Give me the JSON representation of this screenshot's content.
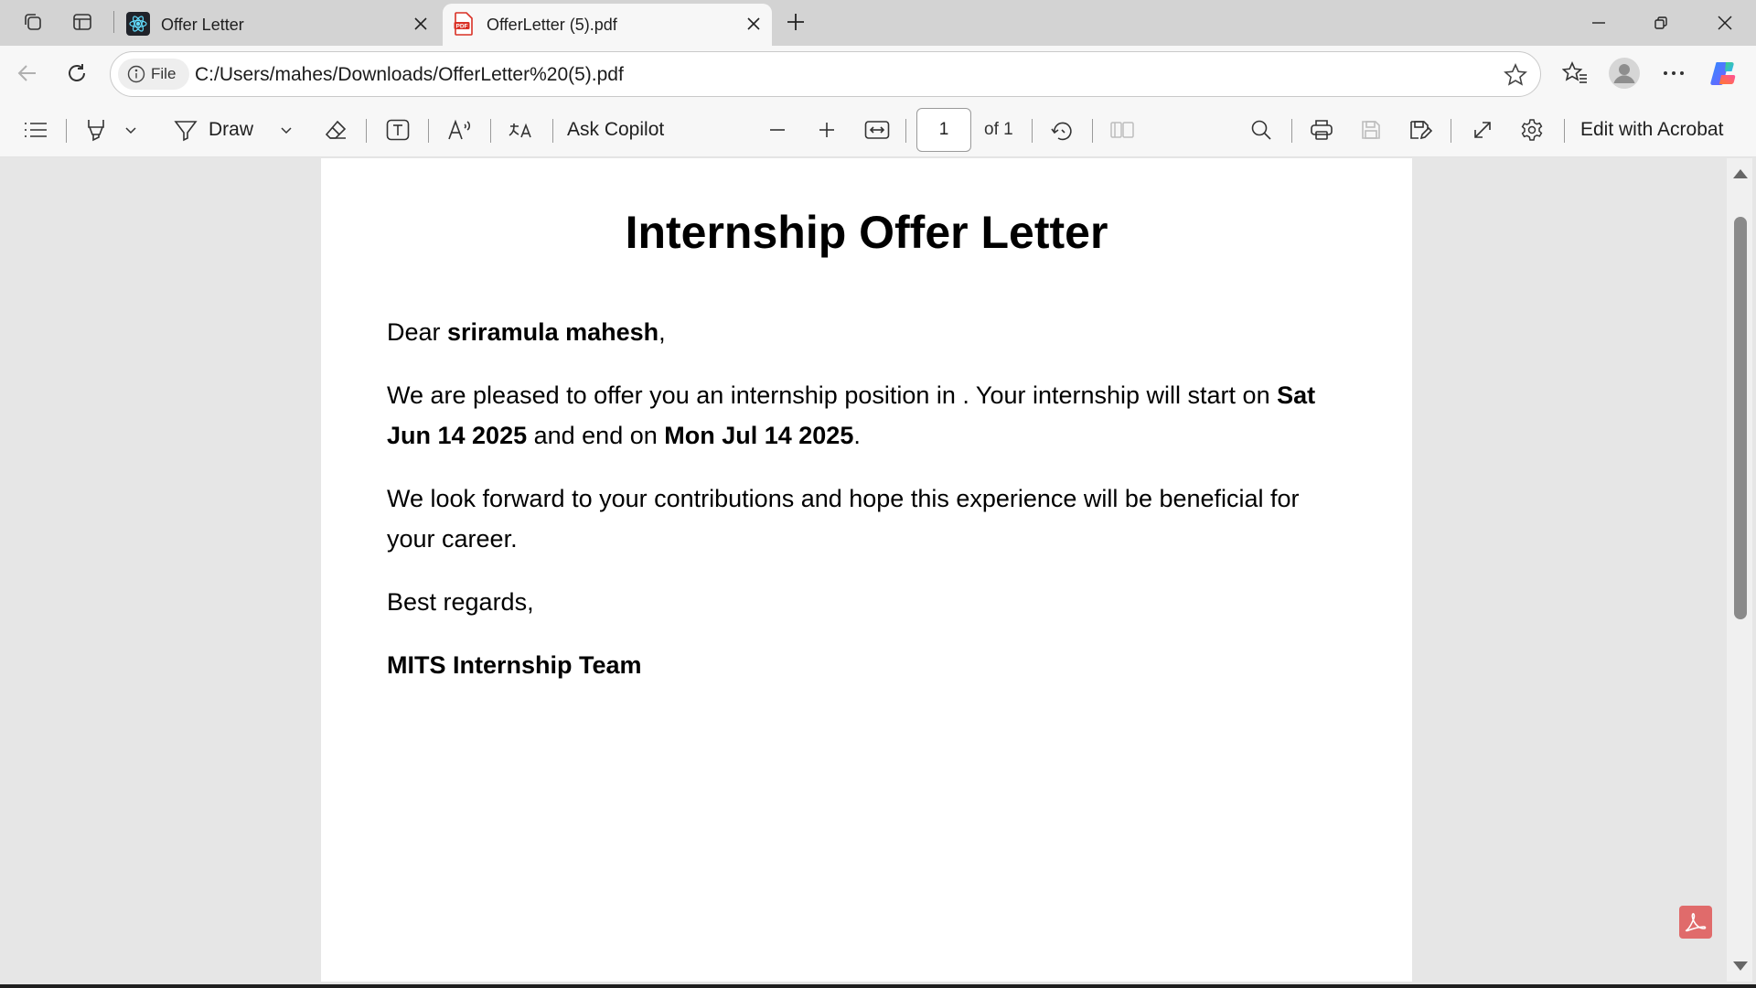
{
  "browser": {
    "tabs": [
      {
        "title": "Offer Letter",
        "icon": "react-icon",
        "active": false
      },
      {
        "title": "OfferLetter (5).pdf",
        "icon": "pdf-icon",
        "active": true
      }
    ],
    "new_tab_icon": "plus-icon",
    "window_controls": [
      "minimize-icon",
      "restore-icon",
      "close-icon"
    ]
  },
  "address_bar": {
    "scheme_label": "File",
    "url": "C:/Users/mahes/Downloads/OfferLetter%20(5).pdf"
  },
  "pdf_toolbar": {
    "draw_label": "Draw",
    "ask_copilot_label": "Ask Copilot",
    "page_current": "1",
    "page_total_label": "of 1",
    "edit_acrobat_label": "Edit with Acrobat"
  },
  "document": {
    "title": "Internship Offer Letter",
    "greeting_prefix": "Dear ",
    "recipient": "sriramula mahesh",
    "greeting_suffix": ",",
    "para1_a": "We are pleased to offer you an internship position in . Your internship will start on ",
    "start_date": "Sat Jun 14 2025",
    "para1_b": " and end on ",
    "end_date": "Mon Jul 14 2025",
    "para1_c": ".",
    "para2": "We look forward to your contributions and hope this experience will be beneficial for your career.",
    "closing": "Best regards,",
    "signature": "MITS Internship Team"
  },
  "colors": {
    "tabstrip_bg": "#d3d3d3",
    "toolbar_bg": "#f7f7f7",
    "viewer_bg": "#e6e6e6",
    "acrobat_red": "#e06b6b"
  }
}
